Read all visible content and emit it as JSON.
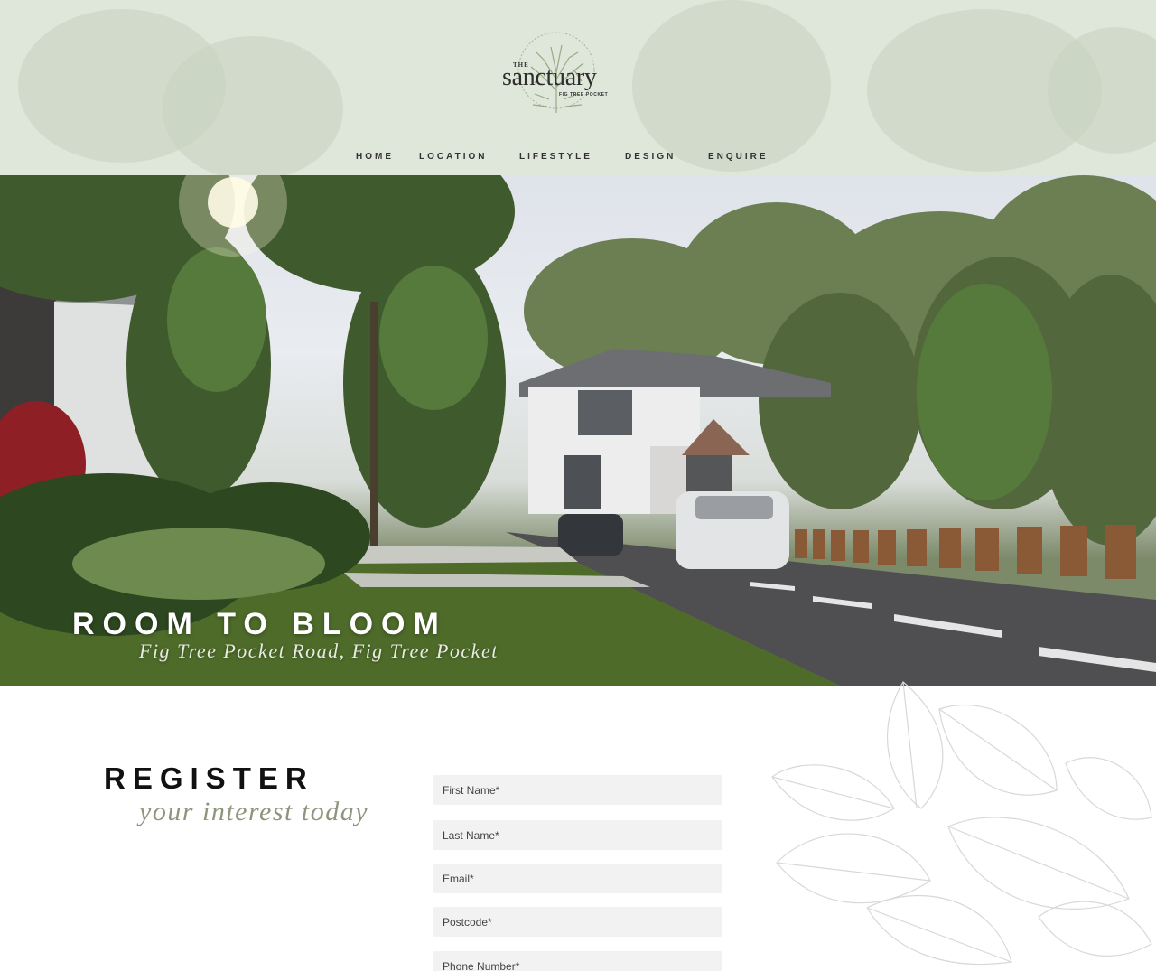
{
  "brand": {
    "the": "THE",
    "name": "sanctuary",
    "location": "FIG TREE POCKET"
  },
  "nav": {
    "items": [
      {
        "label": "HOME"
      },
      {
        "label": "LOCATION"
      },
      {
        "label": "LIFESTYLE"
      },
      {
        "label": "DESIGN"
      },
      {
        "label": "ENQUIRE"
      }
    ]
  },
  "hero": {
    "title": "ROOM TO BLOOM",
    "subtitle": "Fig Tree Pocket Road, Fig Tree Pocket"
  },
  "register": {
    "title": "REGISTER",
    "subtitle": "your interest today",
    "fields": [
      {
        "placeholder": "First Name*"
      },
      {
        "placeholder": "Last Name*"
      },
      {
        "placeholder": "Email*"
      },
      {
        "placeholder": "Postcode*"
      },
      {
        "placeholder": "Phone Number*"
      }
    ]
  },
  "colors": {
    "header_bg": "#dfe6da",
    "accent_sage": "#8d967c",
    "field_bg": "#f2f2f2",
    "text_dark": "#111111"
  },
  "icons": {
    "logo": "tree-logo-icon",
    "decoration": "fig-leaf-line-art"
  }
}
